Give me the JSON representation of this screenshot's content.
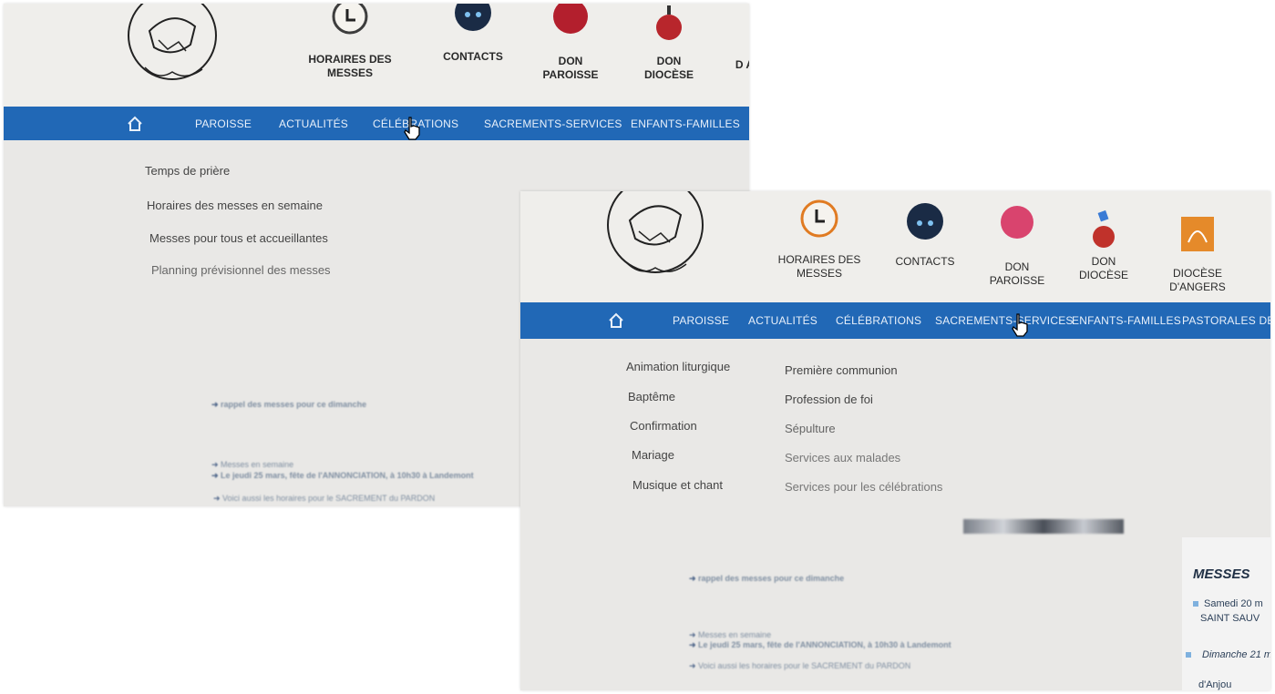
{
  "colors": {
    "nav_bar": "#2168b6",
    "nav_text": "#e8f0fa",
    "page_bg": "#e9e8e6",
    "contacts_icon": "#1a2b45",
    "don_paroisse_icon": "#d9446e",
    "don_diocese_icon": "#c0322b",
    "horaires_icon": "#e07b22"
  },
  "icons": {
    "home": "home-icon",
    "horaires": "clock-icon",
    "contacts": "phone-icon",
    "don_paroisse": "donation-icon",
    "don_diocese": "donation-icon",
    "diocese_angers": "diocese-logo-icon",
    "cursor": "hand-pointer-icon"
  },
  "screen1": {
    "header": {
      "horaires": "HORAIRES DES MESSES",
      "contacts": "CONTACTS",
      "don_paroisse": "DON PAROISSE",
      "don_diocese": "DON DIOCÈSE",
      "partial": "D A"
    },
    "nav": {
      "paroisse": "PAROISSE",
      "actualites": "ACTUALITÉS",
      "celebrations": "CÉLÉBRATIONS",
      "sacrements": "SACREMENTS-SERVICES",
      "enfants": "ENFANTS-FAMILLES"
    },
    "dropdown": [
      "Temps de prière",
      "Horaires des messes en semaine",
      "Messes pour tous et accueillantes",
      "Planning prévisionnel des messes"
    ],
    "content": {
      "line1": "rappel des messes pour ce dimanche",
      "line2": "Messes en semaine",
      "line3": "Le jeudi 25 mars, fête de l'ANNONCIATION, à 10h30 à Landemont",
      "line4": "Voici aussi les horaires pour le SACREMENT du PARDON"
    }
  },
  "screen2": {
    "header": {
      "horaires": "HORAIRES DES MESSES",
      "contacts": "CONTACTS",
      "don_paroisse": "DON PAROISSE",
      "don_diocese": "DON DIOCÈSE",
      "diocese_angers": "DIOCÈSE D'ANGERS"
    },
    "nav": {
      "paroisse": "PAROISSE",
      "actualites": "ACTUALITÉS",
      "celebrations": "CÉLÉBRATIONS",
      "sacrements": "SACREMENTS-SERVICES",
      "enfants": "ENFANTS-FAMILLES",
      "pastorales": "PASTORALES DES JEU"
    },
    "dropdown_col1": [
      "Animation liturgique",
      "Baptême",
      "Confirmation",
      "Mariage",
      "Musique et chant"
    ],
    "dropdown_col2": [
      "Première communion",
      "Profession de foi",
      "Sépulture",
      "Services aux malades",
      "Services pour les célébrations"
    ],
    "content": {
      "line1": "rappel des messes pour ce dimanche",
      "line2": "Messes en semaine",
      "line3": "Le jeudi 25 mars, fête de l'ANNONCIATION, à 10h30 à Landemont",
      "line4": "Voici aussi les horaires pour le SACREMENT du PARDON"
    },
    "sidebar": {
      "title": "MESSES",
      "item1": "Samedi 20 m",
      "item1_place": "SAINT SAUV",
      "item2": "Dimanche 21 m",
      "item2_place": "d'Anjou"
    }
  }
}
